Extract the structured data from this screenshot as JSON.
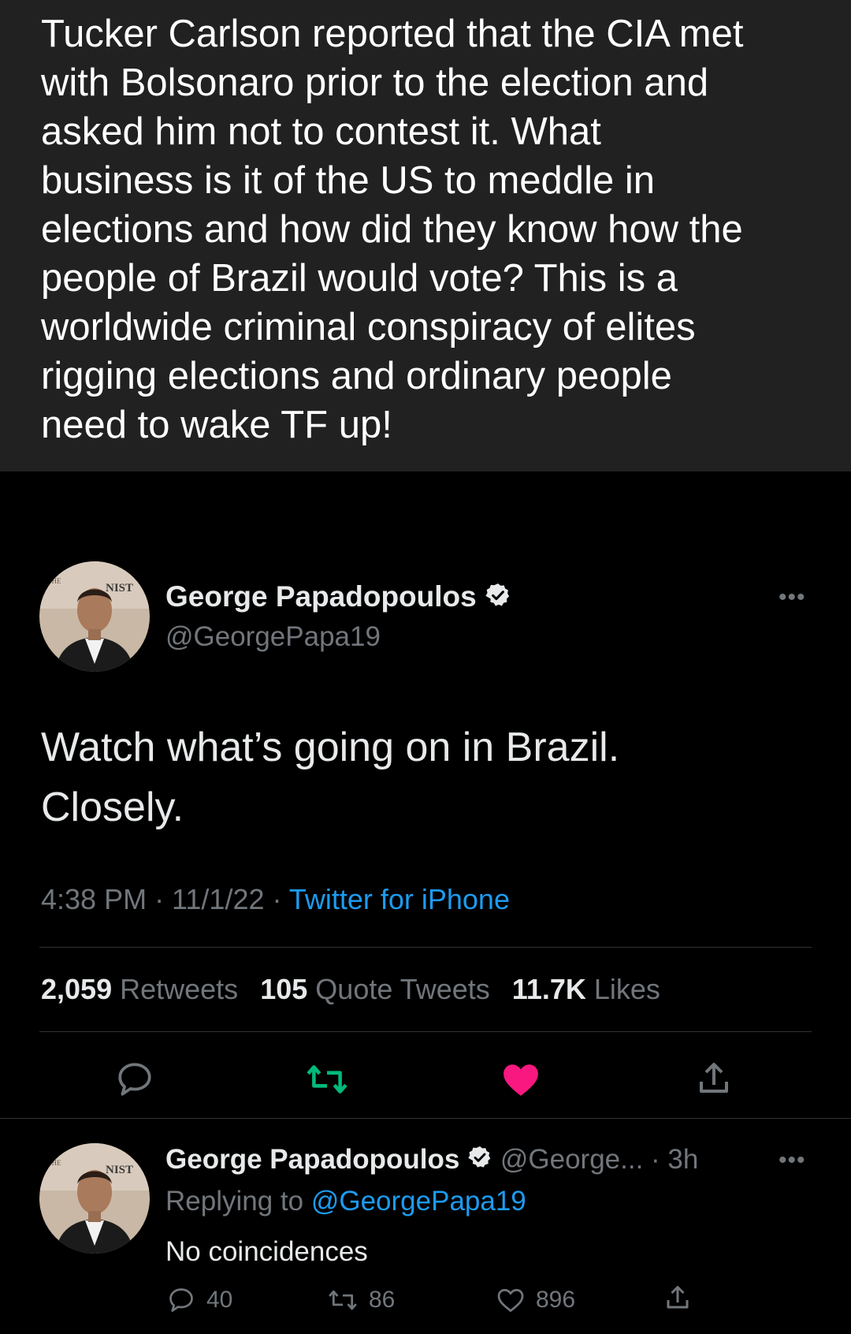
{
  "caption": {
    "text": "Tucker Carlson reported that the CIA met\nwith Bolsonaro prior to the election and\nasked him not to contest it. What\nbusiness is it of the US to meddle in\nelections and how did they know how the\npeople of Brazil would vote?  This is a\nworldwide criminal conspiracy of elites\nrigging elections and ordinary people\nneed to wake TF up!"
  },
  "tweet": {
    "author_name": "George Papadopoulos",
    "author_handle": "@GeorgePapa19",
    "more_label": "•••",
    "text": "Watch what’s going on in Brazil.\nClosely.",
    "time": "4:38 PM · 11/1/22 · ",
    "source": "Twitter for iPhone",
    "stats": {
      "retweets_count": "2,059",
      "retweets_label": "Retweets",
      "quotes_count": "105",
      "quotes_label": "Quote Tweets",
      "likes_count": "11.7K",
      "likes_label": "Likes"
    },
    "colors": {
      "retweet": "#00ba7c",
      "like": "#f91880",
      "link": "#1d9bf0",
      "muted": "#71767b"
    },
    "icons": [
      "reply-icon",
      "retweet-icon",
      "like-icon",
      "share-icon"
    ]
  },
  "reply": {
    "author_name": "George Papadopoulos",
    "author_handle_time": "@George... · 3h",
    "more_label": "•••",
    "replying_prefix": "Replying to ",
    "replying_to": "@GeorgePapa19",
    "text": "No coincidences",
    "reply_count": "40",
    "retweet_count": "86",
    "like_count": "896"
  }
}
